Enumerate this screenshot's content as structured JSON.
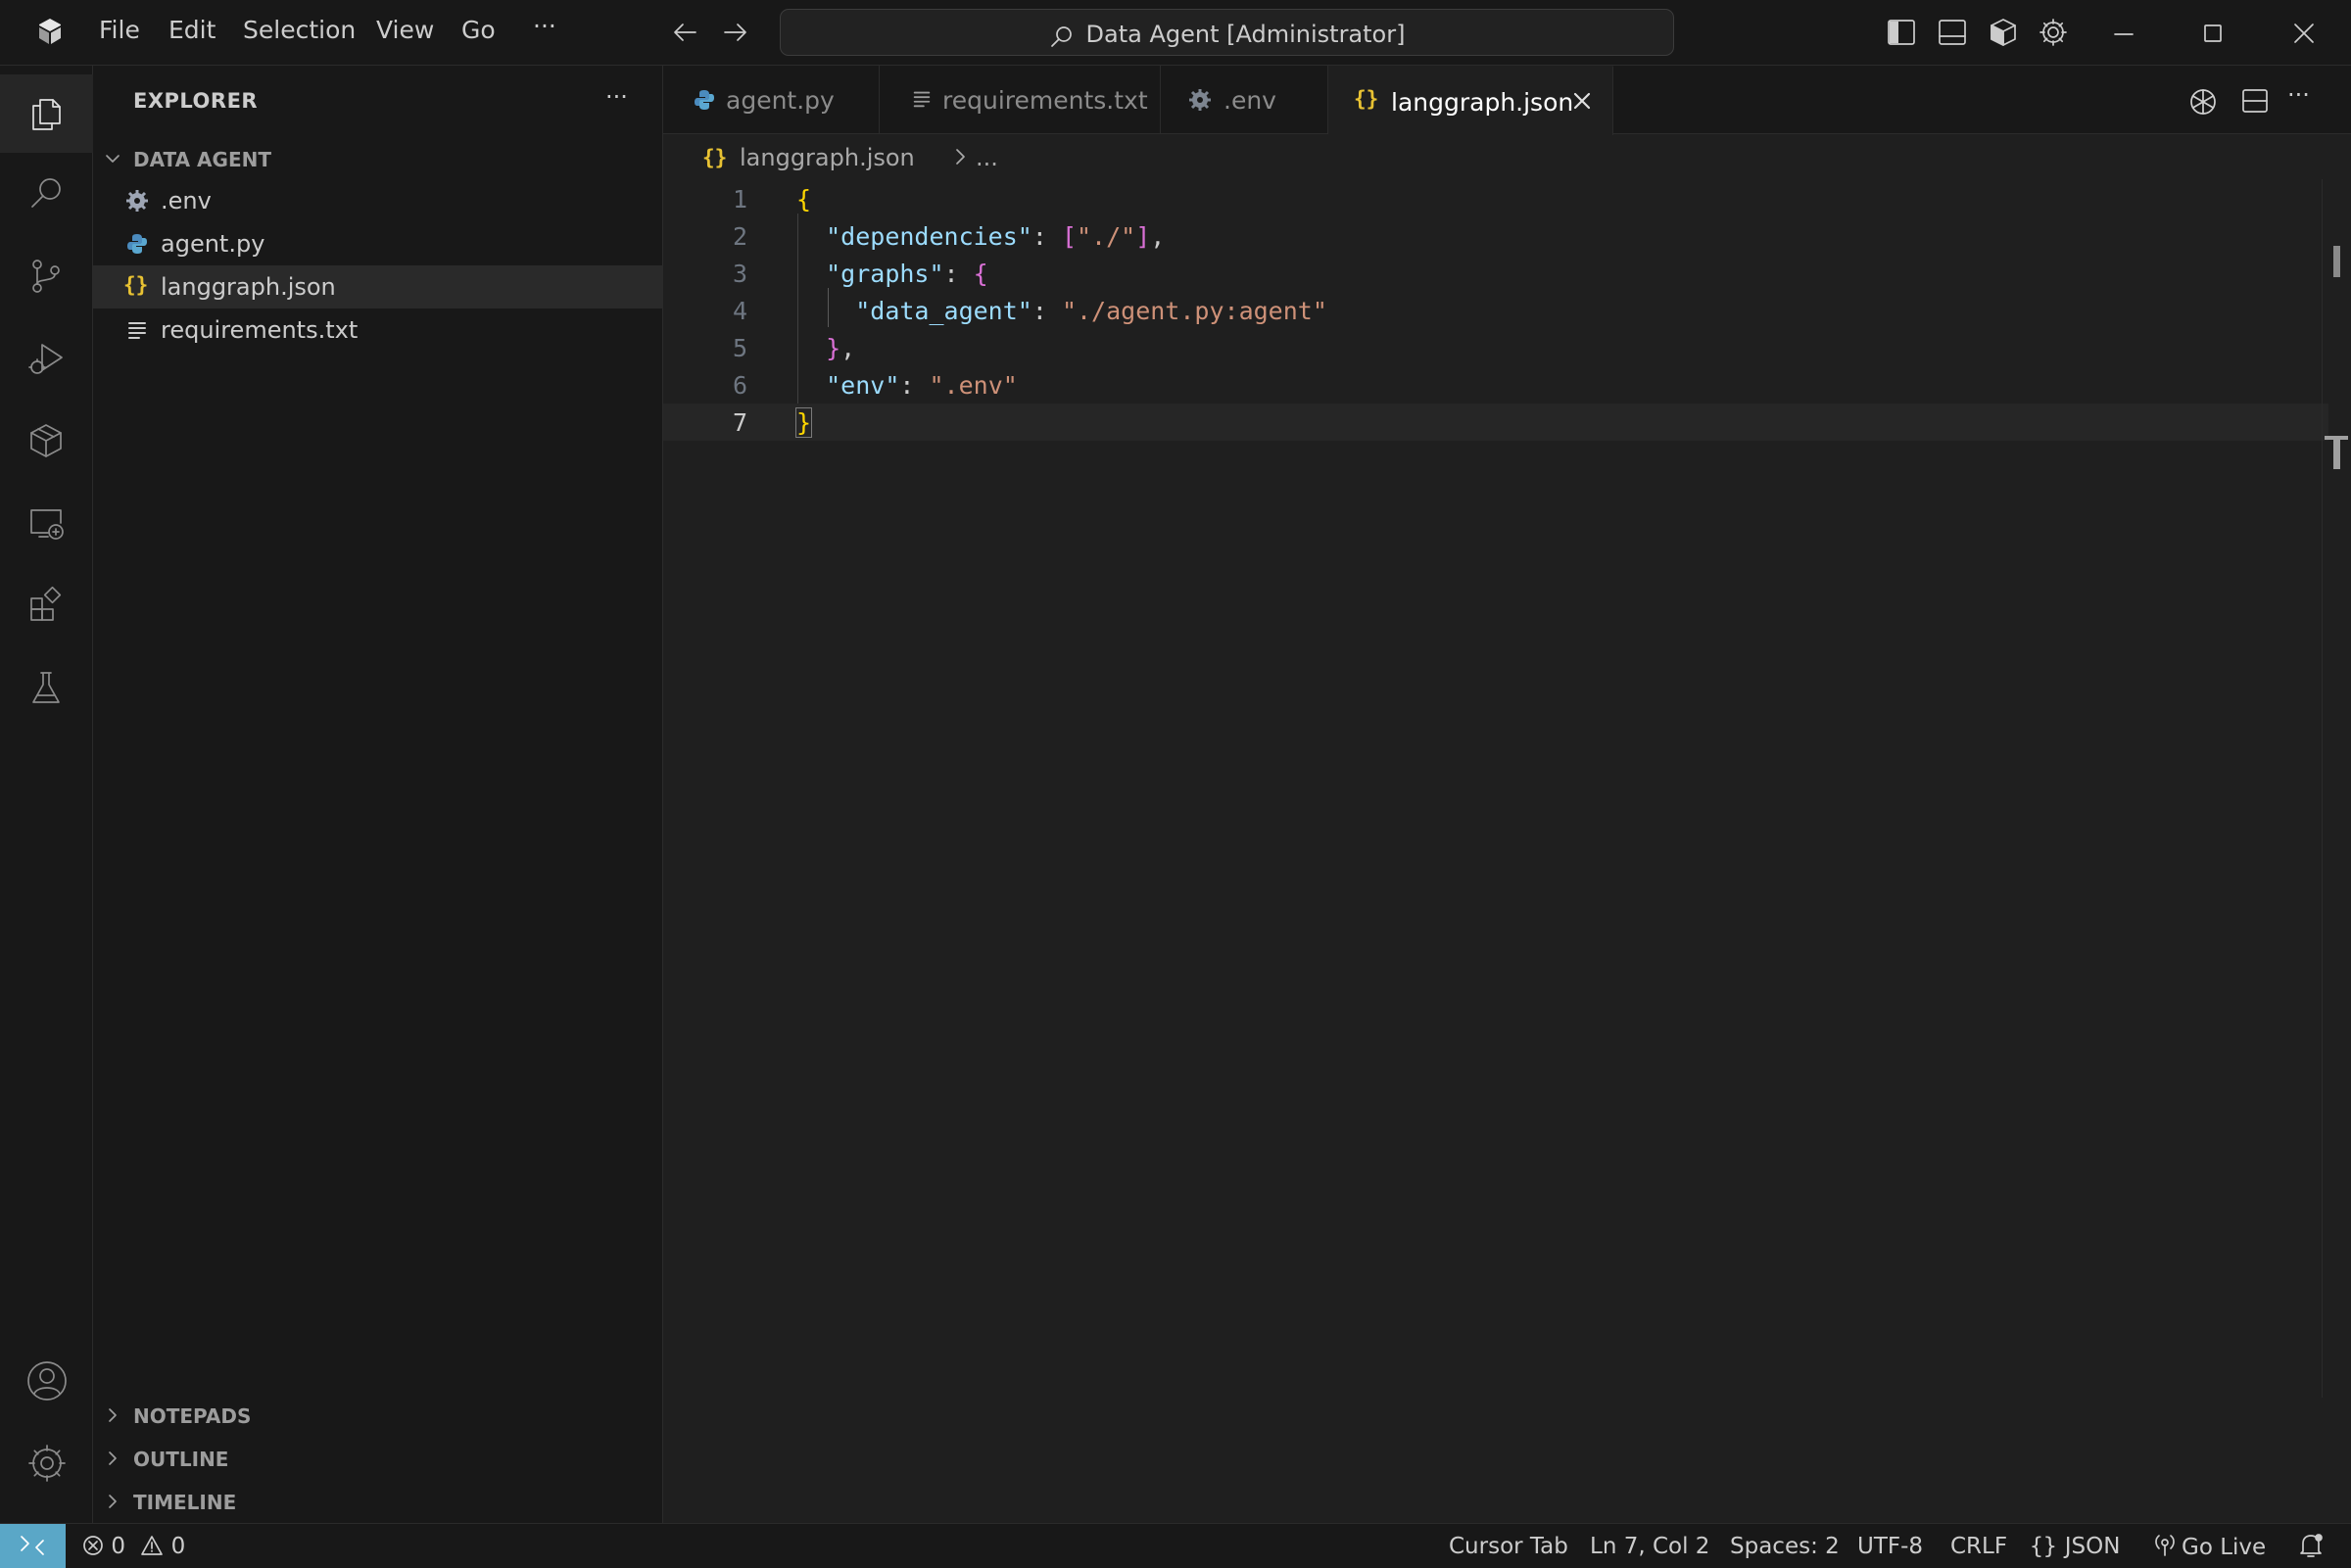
{
  "app": {
    "search_title": "Data Agent [Administrator]",
    "menu": [
      "File",
      "Edit",
      "Selection",
      "View",
      "Go",
      "···"
    ]
  },
  "activity_bar": {
    "items": [
      "explorer",
      "search",
      "source-control",
      "run-and-debug",
      "packages",
      "remote-explorer",
      "extensions",
      "testing"
    ],
    "bottom": [
      "accounts",
      "manage"
    ]
  },
  "sidebar": {
    "title": "EXPLORER",
    "more": "···",
    "folder": "DATA AGENT",
    "files": [
      {
        "name": ".env",
        "icon": "gear-icon"
      },
      {
        "name": "agent.py",
        "icon": "python-icon"
      },
      {
        "name": "langgraph.json",
        "icon": "json-icon"
      },
      {
        "name": "requirements.txt",
        "icon": "text-file-icon"
      }
    ],
    "sections": [
      "NOTEPADS",
      "OUTLINE",
      "TIMELINE"
    ]
  },
  "tabs": [
    {
      "label": "agent.py",
      "icon": "python-icon"
    },
    {
      "label": "requirements.txt",
      "icon": "text-file-icon"
    },
    {
      "label": ".env",
      "icon": "gear-icon"
    },
    {
      "label": "langgraph.json",
      "icon": "json-icon",
      "active": true
    }
  ],
  "breadcrumb": {
    "icon": "{}",
    "file": "langgraph.json",
    "rest": "..."
  },
  "editor": {
    "line_numbers": [
      "1",
      "2",
      "3",
      "4",
      "5",
      "6",
      "7"
    ],
    "current_line": 7,
    "code": {
      "l1_open": "{",
      "l2_key": "\"dependencies\"",
      "l2_colon": ": ",
      "l2_val_open": "[",
      "l2_val": "\"./\"",
      "l2_val_close": "]",
      "l2_comma": ",",
      "l3_key": "\"graphs\"",
      "l3_colon": ": ",
      "l3_open": "{",
      "l4_key": "\"data_agent\"",
      "l4_colon": ": ",
      "l4_val": "\"./agent.py:agent\"",
      "l5_close": "}",
      "l5_comma": ",",
      "l6_key": "\"env\"",
      "l6_colon": ": ",
      "l6_val": "\".env\"",
      "l7_close": "}"
    }
  },
  "status": {
    "errors": "0",
    "warnings": "0",
    "cursor_tab": "Cursor Tab",
    "position": "Ln 7, Col 2",
    "spaces": "Spaces: 2",
    "encoding": "UTF-8",
    "eol": "CRLF",
    "language_icon": "{}",
    "language": "JSON",
    "go_live": "Go Live"
  },
  "colors": {
    "background": "#181818",
    "editor_bg": "#1f1f1f",
    "json_key": "#9cdcfe",
    "json_string": "#ce9178",
    "bracket_level1": "#ffd700",
    "bracket_level2": "#da70d6",
    "remote_indicator": "#5aa7c7"
  }
}
